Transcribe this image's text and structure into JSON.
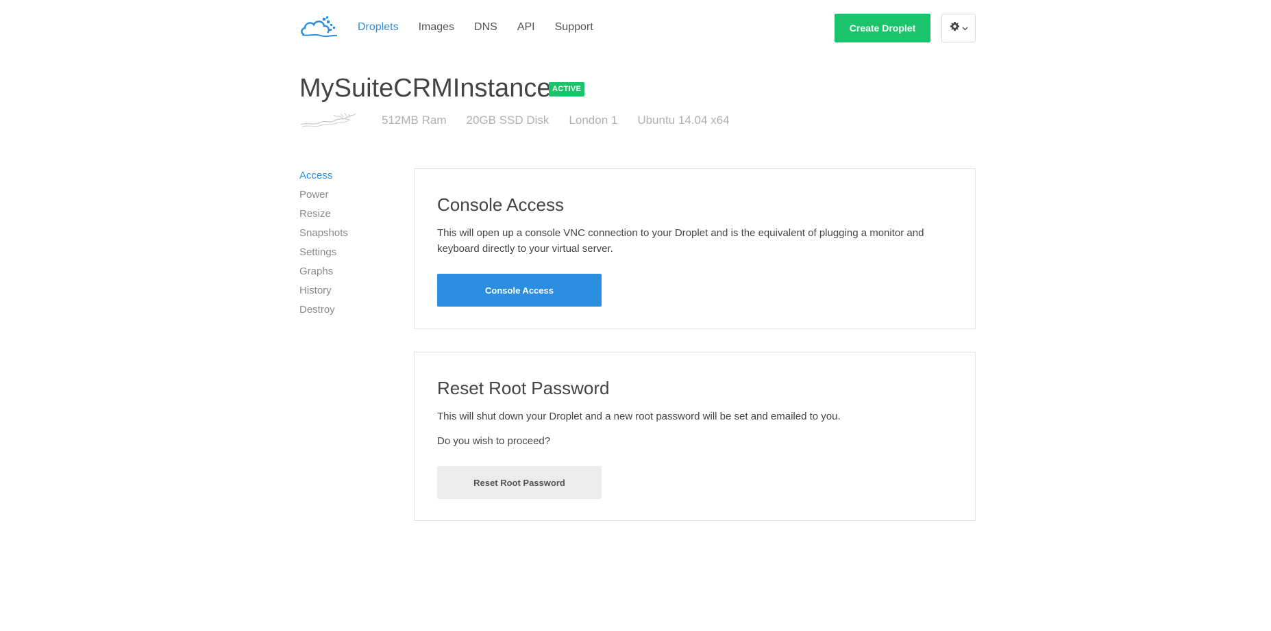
{
  "header": {
    "logo_icon": "cloud-logo-icon",
    "nav": [
      {
        "label": "Droplets",
        "active": true
      },
      {
        "label": "Images",
        "active": false
      },
      {
        "label": "DNS",
        "active": false
      },
      {
        "label": "API",
        "active": false
      },
      {
        "label": "Support",
        "active": false
      }
    ],
    "create_label": "Create Droplet",
    "settings_icon": "gear-icon",
    "settings_caret_icon": "chevron-down-icon"
  },
  "droplet": {
    "name": "MySuiteCRMInstance",
    "status": "ACTIVE",
    "distro_icon": "ubuntu-logo-icon",
    "specs": [
      "512MB Ram",
      "20GB SSD Disk",
      "London 1",
      "Ubuntu 14.04 x64"
    ]
  },
  "sidebar": {
    "items": [
      {
        "label": "Access",
        "active": true
      },
      {
        "label": "Power",
        "active": false
      },
      {
        "label": "Resize",
        "active": false
      },
      {
        "label": "Snapshots",
        "active": false
      },
      {
        "label": "Settings",
        "active": false
      },
      {
        "label": "Graphs",
        "active": false
      },
      {
        "label": "History",
        "active": false
      },
      {
        "label": "Destroy",
        "active": false
      }
    ]
  },
  "console": {
    "title": "Console Access",
    "description": "This will open up a console VNC connection to your Droplet and is the equivalent of plugging a monitor and keyboard directly to your virtual server.",
    "button_label": "Console Access"
  },
  "reset": {
    "title": "Reset Root Password",
    "description": "This will shut down your Droplet and a new root password will be set and emailed to you.",
    "question": "Do you wish to proceed?",
    "button_label": "Reset Root Password"
  },
  "colors": {
    "accent": "#2b8ee0",
    "success": "#1bc46b"
  }
}
